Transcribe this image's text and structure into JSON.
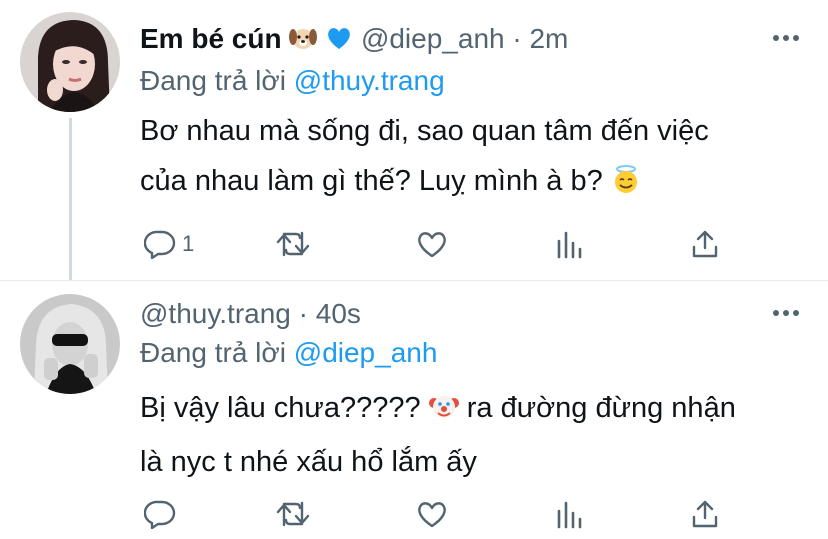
{
  "tweets": [
    {
      "display_name": "Em bé cún",
      "name_emojis": [
        "dog-face-emoji",
        "blue-heart-emoji"
      ],
      "handle": "@diep_anh",
      "separator": "·",
      "time": "2m",
      "reply_prefix": "Đang trả lời",
      "reply_to": "@thuy.trang",
      "text_line1": "Bơ nhau mà sống đi, sao quan tâm đến việc",
      "text_line2": "của nhau làm gì thế? Luỵ mình à b?",
      "text_emoji": "smiling-face-with-halo-emoji",
      "reply_count": "1",
      "actions": [
        "reply-icon",
        "retweet-icon",
        "like-icon",
        "analytics-icon",
        "share-icon"
      ]
    },
    {
      "display_name": "",
      "handle": "@thuy.trang",
      "separator": "·",
      "time": "40s",
      "reply_prefix": "Đang trả lời",
      "reply_to": "@diep_anh",
      "text_part1": "Bị vậy lâu chưa?????",
      "text_emoji": "clown-face-emoji",
      "text_part2": "ra đường đừng nhận",
      "text_line2": "là nyc t nhé xấu hổ lắm ấy",
      "reply_count": "",
      "actions": [
        "reply-icon",
        "retweet-icon",
        "like-icon",
        "analytics-icon",
        "share-icon"
      ]
    }
  ],
  "colors": {
    "text": "#0f1419",
    "secondary": "#536471",
    "mention": "#1d9bf0",
    "divider": "#e7e9ea",
    "thread_line": "#cfd9de",
    "heart": "#1d9bf0"
  }
}
